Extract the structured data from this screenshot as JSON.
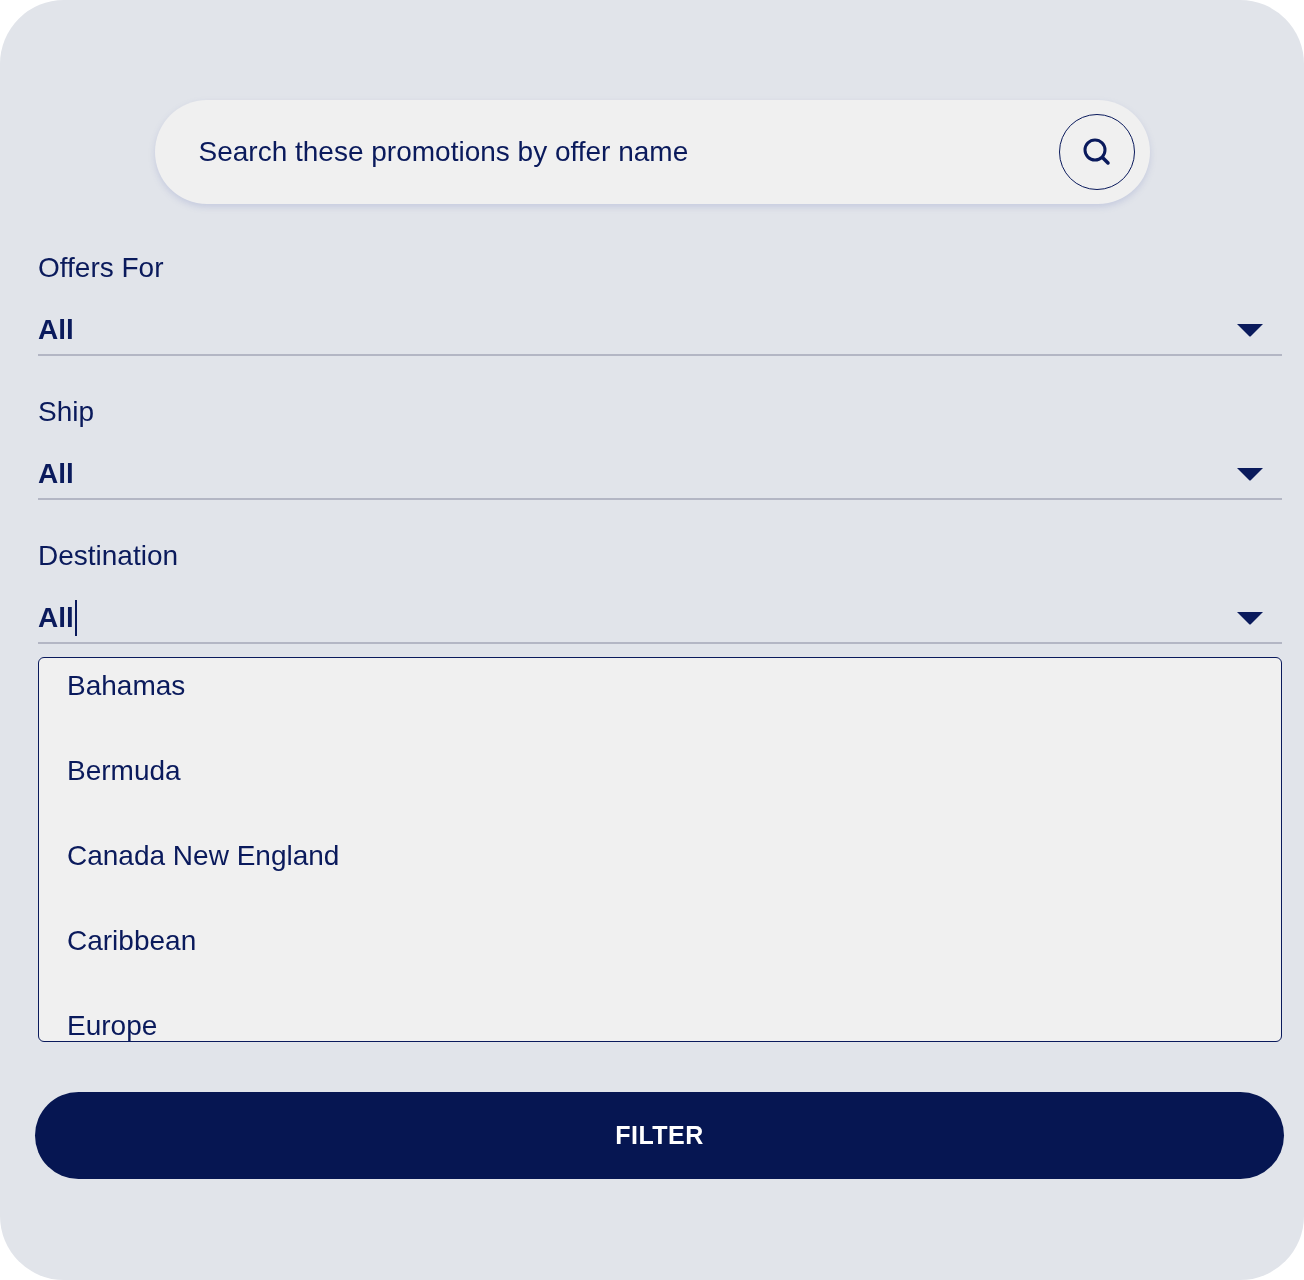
{
  "search": {
    "placeholder": "Search these promotions by offer name"
  },
  "filters": [
    {
      "label": "Offers For",
      "value": "All",
      "focused": false
    },
    {
      "label": "Ship",
      "value": "All",
      "focused": false
    },
    {
      "label": "Destination",
      "value": "All",
      "focused": true
    }
  ],
  "destination_options": [
    "Bahamas",
    "Bermuda",
    "Canada New England",
    "Caribbean",
    "Europe"
  ],
  "filter_button": "FILTER"
}
